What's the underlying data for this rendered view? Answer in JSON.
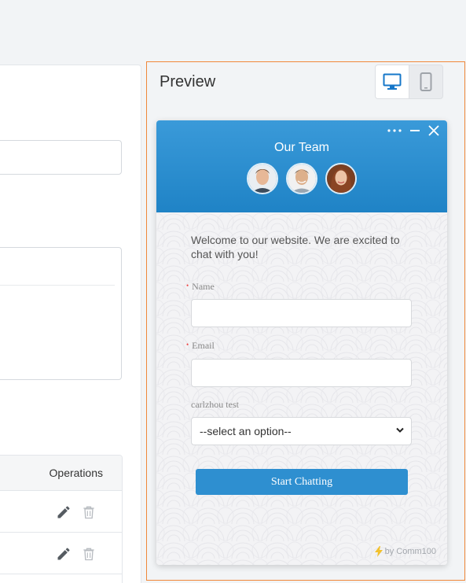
{
  "preview": {
    "title": "Preview",
    "devices": [
      {
        "name": "desktop",
        "active": true
      },
      {
        "name": "mobile",
        "active": false
      }
    ]
  },
  "left_table": {
    "operations_header": "Operations",
    "rows": [
      {
        "edit_icon": "pencil-icon",
        "delete_icon": "trash-icon"
      },
      {
        "edit_icon": "pencil-icon",
        "delete_icon": "trash-icon"
      }
    ]
  },
  "widget": {
    "title": "Our Team",
    "welcome": "Welcome to our website. We are excited to chat with you!",
    "fields": {
      "name_label": "Name",
      "email_label": "Email",
      "custom_label": "carlzhou test",
      "select_value": "--select an option--"
    },
    "start_button": "Start Chatting",
    "powered_by": "by Comm100"
  },
  "colors": {
    "accent": "#2e8fd0",
    "header_top": "#3a9ad9",
    "header_bottom": "#1f83c6",
    "preview_border": "#f0883a",
    "desktop_icon": "#1677c9",
    "required_dot": "#e44444"
  }
}
